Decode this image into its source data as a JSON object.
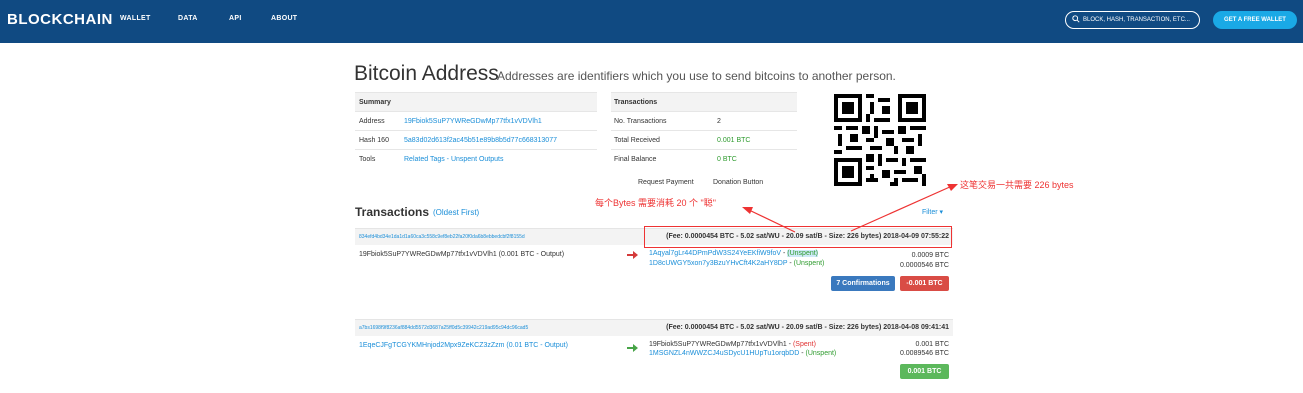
{
  "brand": {
    "logo": "BLOCKCHAIN"
  },
  "nav": {
    "items": [
      "WALLET",
      "DATA",
      "API",
      "ABOUT"
    ]
  },
  "search": {
    "placeholder": "BLOCK, HASH, TRANSACTION, ETC..."
  },
  "wallet_button": "GET A FREE WALLET",
  "page": {
    "title": "Bitcoin Address",
    "subtitle": "Addresses are identifiers which you use to send bitcoins to another person."
  },
  "summary": {
    "heading": "Summary",
    "rows": [
      {
        "label": "Address",
        "value": "19Fbiok5SuP7YWReGDwMp77tfx1vVDVlh1"
      },
      {
        "label": "Hash 160",
        "value": "5a83d02d613f2ac45b51e89b8b5d77c668313077"
      },
      {
        "label": "Tools",
        "value": "Related Tags - Unspent Outputs"
      }
    ]
  },
  "transactions_summary": {
    "heading": "Transactions",
    "rows": [
      {
        "label": "No. Transactions",
        "value": "2"
      },
      {
        "label": "Total Received",
        "value": "0.001 BTC"
      },
      {
        "label": "Final Balance",
        "value": "0 BTC"
      }
    ]
  },
  "payment_links": {
    "request": "Request Payment",
    "donation": "Donation Button"
  },
  "transactions": {
    "heading": "Transactions",
    "oldest_first": "(Oldest First)",
    "filter": "Filter ▾",
    "items": [
      {
        "hash": "834efd4bd34e1da1d1a60ca3c558c9ef8eb22fa20f0da6b8ebbedcbf2f8155d",
        "meta": "(Fee: 0.0000454 BTC - 5.02 sat/WU - 20.09 sat/B - Size: 226 bytes) 2018-04-09 07:55:22",
        "input": "19Fbiok5SuP7YWReGDwMp77tfx1vVDVlh1 (0.001 BTC - Output)",
        "outputs": [
          {
            "address": "1Aqyal7gLr44DPmPdW3S24YeEKfiW9foV",
            "status": "(Unspent)",
            "amount": "0.0009 BTC"
          },
          {
            "address": "1D8cUWGY5xon7y3BzuYHvCft4K2aHY8DP",
            "status": "(Unspent)",
            "amount": "0.0000546 BTC"
          }
        ],
        "confirmations": "7 Confirmations",
        "net": "-0.001 BTC"
      },
      {
        "hash": "a7bs1698f9f8236af884dd5572d3687a25ff0d5c39942c219ad95c94dc96cad5",
        "meta": "(Fee: 0.0000454 BTC - 5.02 sat/WU - 20.09 sat/B - Size: 226 bytes) 2018-04-08 09:41:41",
        "input": "1EqeCJFgTCGYKMHnjod2Mpx9ZeKCZ3zZzm (0.01 BTC - Output)",
        "outputs": [
          {
            "address": "19Fbiok5SuP7YWReGDwMp77tfx1vVDVlh1",
            "status": "(Spent)",
            "amount": "0.001 BTC"
          },
          {
            "address": "1MSGNZL4nWWZCJ4uSDycU1HUpTu1orqbDD",
            "status": "(Unspent)",
            "amount": "0.0089546 BTC"
          }
        ],
        "net": "0.001 BTC"
      }
    ]
  },
  "annotations": {
    "right": "这笔交易一共需要 226 bytes",
    "left": "每个Bytes 需要消耗 20 个 \"聪\""
  },
  "colors": {
    "topbar": "#104a82",
    "accent": "#1aa9e6",
    "link": "#1a8ed8",
    "green": "#5cb85c",
    "red": "#d9534f",
    "annotation": "#e33"
  }
}
